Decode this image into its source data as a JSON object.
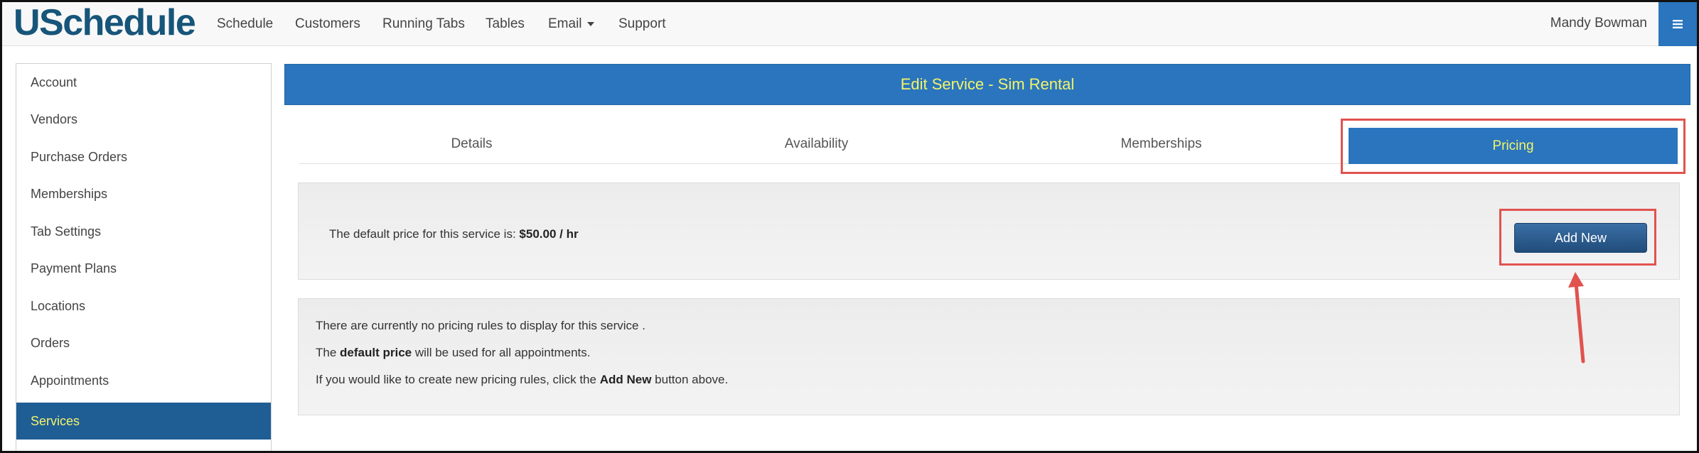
{
  "app": {
    "logo": "USchedule",
    "user_name": "Mandy Bowman"
  },
  "nav": {
    "items": [
      {
        "label": "Schedule"
      },
      {
        "label": "Customers"
      },
      {
        "label": "Running Tabs"
      },
      {
        "label": "Tables"
      },
      {
        "label": "Email"
      },
      {
        "label": "Support"
      }
    ],
    "menu_icon": "hamburger-icon"
  },
  "sidebar": {
    "items": [
      {
        "label": "Account"
      },
      {
        "label": "Vendors"
      },
      {
        "label": "Purchase Orders"
      },
      {
        "label": "Memberships"
      },
      {
        "label": "Tab Settings"
      },
      {
        "label": "Payment Plans"
      },
      {
        "label": "Locations"
      },
      {
        "label": "Orders"
      },
      {
        "label": "Appointments"
      },
      {
        "label": "Services"
      }
    ],
    "active": "Services"
  },
  "page": {
    "title": "Edit Service - Sim Rental",
    "tabs": [
      {
        "label": "Details"
      },
      {
        "label": "Availability"
      },
      {
        "label": "Memberships"
      },
      {
        "label": "Pricing"
      }
    ],
    "active_tab": "Pricing"
  },
  "pricing": {
    "default_price_prefix": "The default price for this service is:",
    "default_price_value": "$50.00 / hr",
    "add_new_label": "Add New",
    "no_rules_text": "There are currently no pricing rules to display for this service .",
    "default_note_prefix": "The",
    "default_note_bold": "default price",
    "default_note_suffix": "will be used for all appointments.",
    "create_prefix": "If you would like to create new pricing rules, click the",
    "create_bold": "Add New",
    "create_suffix": "button above."
  },
  "colors": {
    "brand": "#17557a",
    "primary": "#2a75bd",
    "active_text": "#f3f36a",
    "sidebar_active": "#1f5d95",
    "annotation": "#e1524f"
  }
}
